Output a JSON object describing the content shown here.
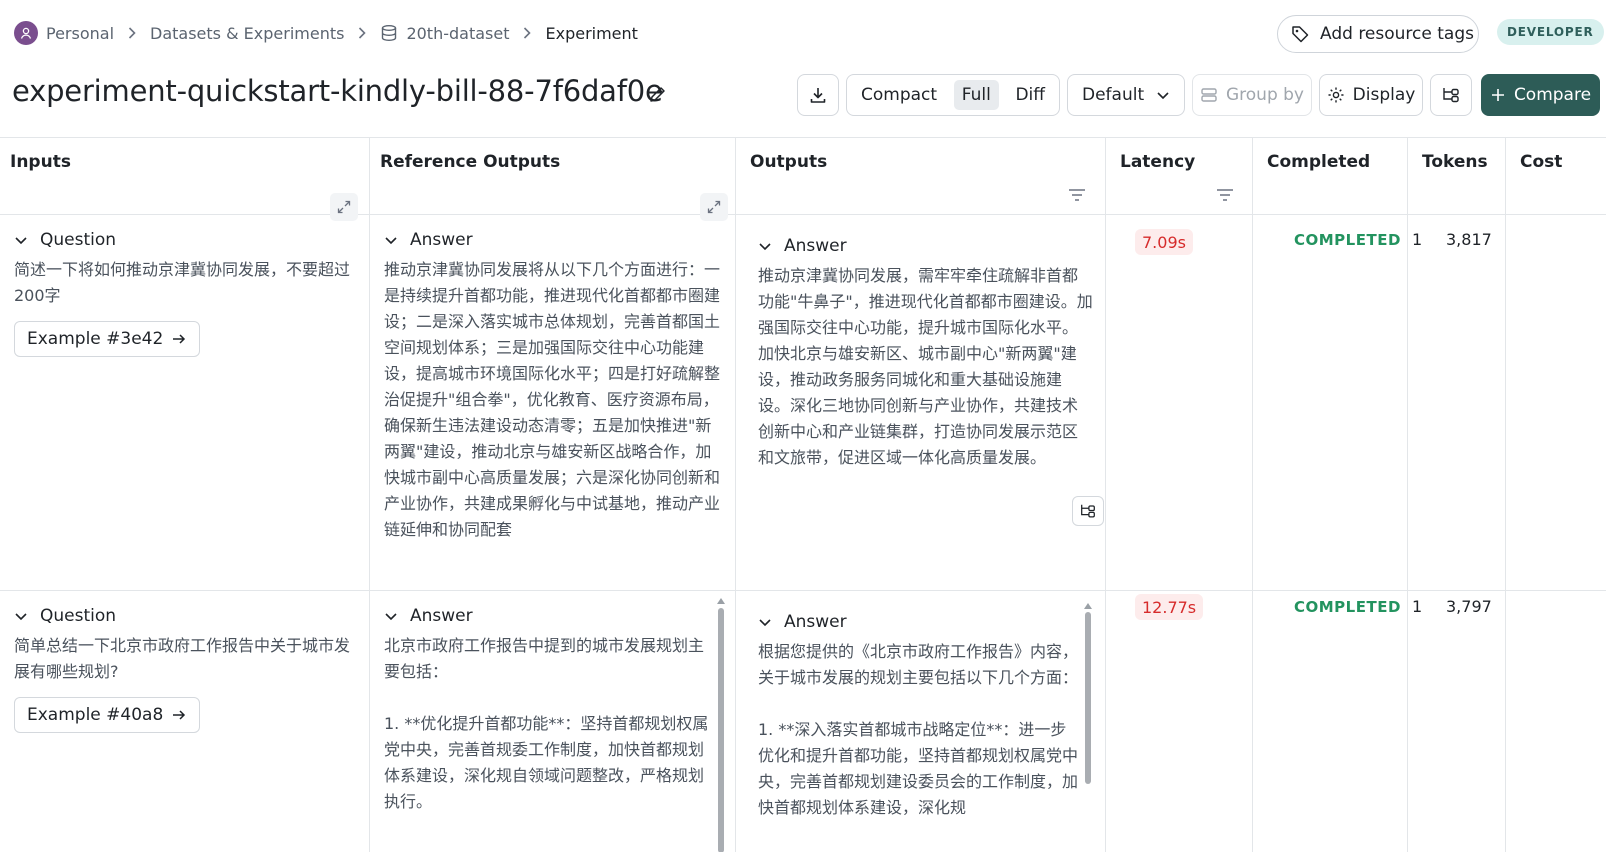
{
  "breadcrumb": {
    "personal": "Personal",
    "datasets": "Datasets & Experiments",
    "dataset": "20th-dataset",
    "current": "Experiment"
  },
  "header": {
    "add_tags": "Add resource tags",
    "badge": "DEVELOPER",
    "title": "experiment-quickstart-kindly-bill-88-7f6daf0e"
  },
  "toolbar": {
    "view_modes": [
      "Compact",
      "Full",
      "Diff"
    ],
    "active_view": "Full",
    "default_select": "Default",
    "group_by": "Group by",
    "display": "Display",
    "compare": "Compare"
  },
  "columns": [
    "Inputs",
    "Reference Outputs",
    "Outputs",
    "Latency",
    "Completed",
    "Tokens",
    "Cost"
  ],
  "rows": [
    {
      "input_label": "Question",
      "input_text": "简述一下将如何推动京津冀协同发展，不要超过200字",
      "example": "Example #3e42",
      "ref_label": "Answer",
      "ref_text": "推动京津冀协同发展将从以下几个方面进行：一是持续提升首都功能，推进现代化首都都市圈建设；二是深入落实城市总体规划，完善首都国土空间规划体系；三是加强国际交往中心功能建设，提高城市环境国际化水平；四是打好疏解整治促提升\"组合拳\"，优化教育、医疗资源布局，确保新生违法建设动态清零；五是加快推进\"新两翼\"建设，推动北京与雄安新区战略合作，加快城市副中心高质量发展；六是深化协同创新和产业协作，共建成果孵化与中试基地，推动产业链延伸和协同配套",
      "out_label": "Answer",
      "out_text": "推动京津冀协同发展，需牢牢牵住疏解非首都功能\"牛鼻子\"，推进现代化首都都市圈建设。加强国际交往中心功能，提升城市国际化水平。加快北京与雄安新区、城市副中心\"新两翼\"建设，推动政务服务同城化和重大基础设施建设。深化三地协同创新与产业协作，共建技术创新中心和产业链集群，打造协同发展示范区和文旅带，促进区域一体化高质量发展。",
      "latency": "7.09s",
      "status": "COMPLETED",
      "status_count": "1",
      "tokens": "3,817"
    },
    {
      "input_label": "Question",
      "input_text": "简单总结一下北京市政府工作报告中关于城市发展有哪些规划?",
      "example": "Example #40a8",
      "ref_label": "Answer",
      "ref_text": "北京市政府工作报告中提到的城市发展规划主要包括：\n\n1. **优化提升首都功能**：坚持首都规划权属党中央，完善首规委工作制度，加快首都规划体系建设，深化规自领域问题整改，严格规划执行。",
      "out_label": "Answer",
      "out_text": "根据您提供的《北京市政府工作报告》内容，关于城市发展的规划主要包括以下几个方面：\n\n1. **深入落实首都城市战略定位**：进一步优化和提升首都功能，坚持首都规划权属党中央，完善首都规划建设委员会的工作制度，加快首都规划体系建设，深化规",
      "latency": "12.77s",
      "status": "COMPLETED",
      "status_count": "1",
      "tokens": "3,797"
    }
  ]
}
